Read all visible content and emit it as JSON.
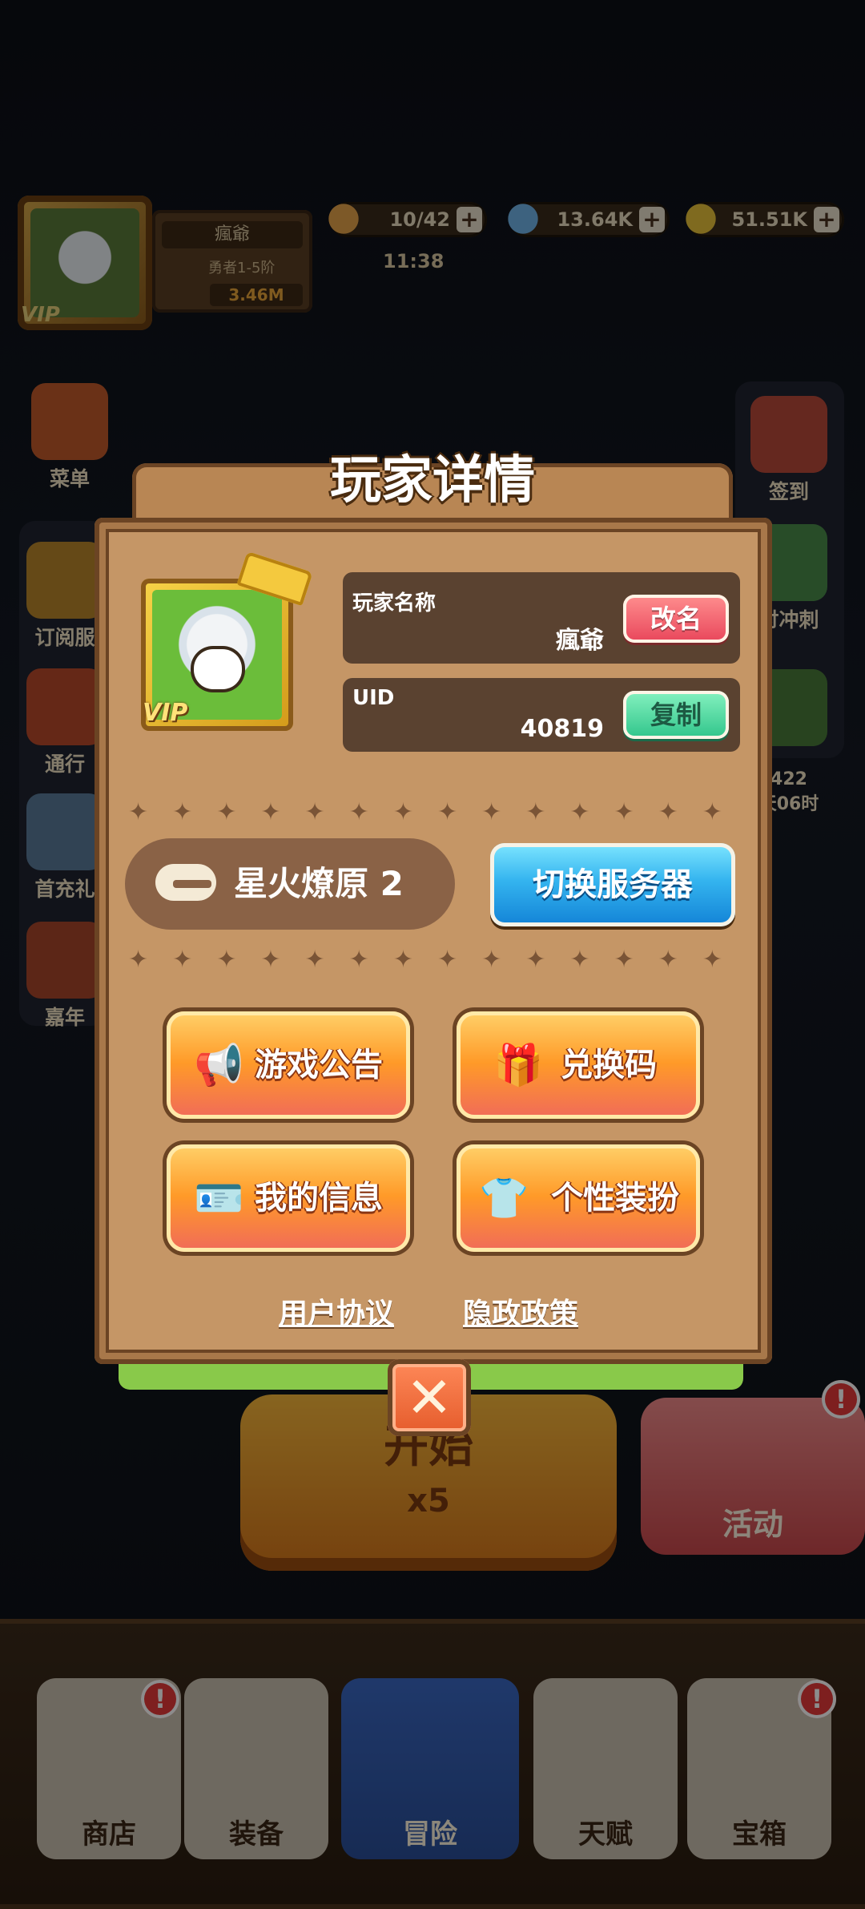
{
  "hud": {
    "player_name": "瘋爺",
    "rank": "勇者1-5阶",
    "power": "3.46M",
    "avatar_badge": "VIP",
    "stamina": "10/42",
    "gems": "13.64K",
    "coins": "51.51K",
    "timer": "11:38",
    "plus": "+"
  },
  "side_left": [
    {
      "label": "菜单",
      "icon": "menu-book-icon"
    },
    {
      "label": "订阅服",
      "icon": "subscription-icon"
    },
    {
      "label": "通行",
      "icon": "pass-icon"
    },
    {
      "label": "首充礼",
      "icon": "first-recharge-icon"
    },
    {
      "label": "嘉年",
      "icon": "carnival-icon"
    }
  ],
  "side_right": [
    {
      "label": "签到",
      "icon": "calendar-icon"
    },
    {
      "label": "讨冲刺",
      "icon": "sprint-icon"
    },
    {
      "label": "422\n天06时",
      "icon": "event-icon"
    }
  ],
  "start": {
    "label": "开始",
    "cost": "x5"
  },
  "activity": {
    "label": "活动",
    "alert": "!"
  },
  "nav": [
    {
      "label": "商店",
      "icon": "shop-icon",
      "alert": "!"
    },
    {
      "label": "装备",
      "icon": "equipment-icon"
    },
    {
      "label": "冒险",
      "icon": "adventure-icon"
    },
    {
      "label": "天赋",
      "icon": "talent-icon"
    },
    {
      "label": "宝箱",
      "icon": "chest-icon",
      "alert": "!"
    }
  ],
  "modal": {
    "title": "玩家详情",
    "avatar_badge": "VIP",
    "name_label": "玩家名称",
    "name_value": "瘋爺",
    "rename_button": "改名",
    "uid_label": "UID",
    "uid_value": "40819",
    "copy_button": "复制",
    "server_name": "星火燎原 2",
    "switch_server_button": "切换服务器",
    "buttons": [
      {
        "label": "游戏公告",
        "icon": "megaphone-icon"
      },
      {
        "label": "兑换码",
        "icon": "gift-icon"
      },
      {
        "label": "我的信息",
        "icon": "id-card-icon"
      },
      {
        "label": "个性装扮",
        "icon": "tshirt-icon"
      }
    ],
    "user_agreement": "用户协议",
    "privacy_policy": "隐政政策",
    "close": "✕"
  }
}
